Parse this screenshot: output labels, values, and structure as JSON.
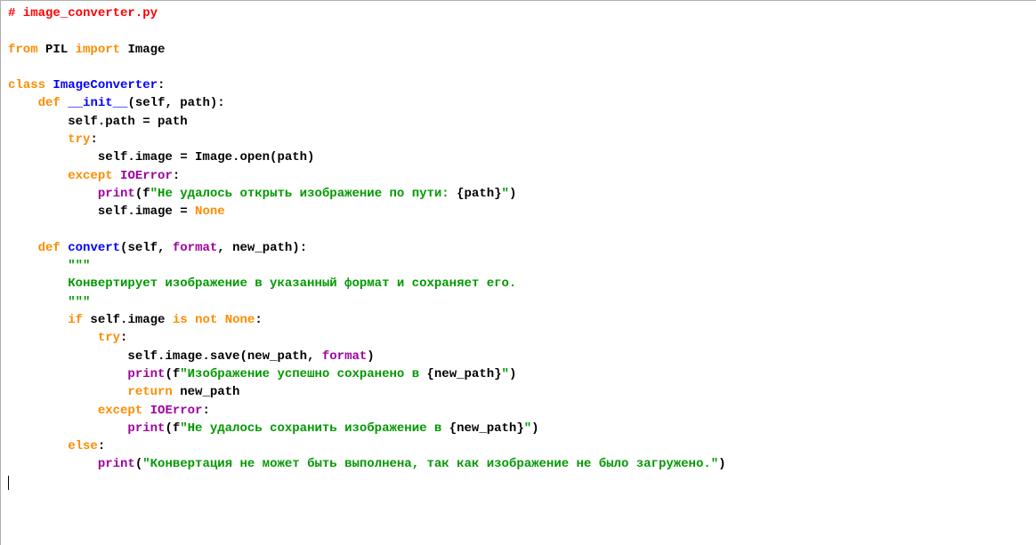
{
  "code": {
    "lines": [
      [
        {
          "cls": "c-comment",
          "text": "# image_converter.py"
        }
      ],
      [],
      [
        {
          "cls": "c-keyword",
          "text": "from"
        },
        {
          "cls": "c-text",
          "text": " PIL "
        },
        {
          "cls": "c-keyword",
          "text": "import"
        },
        {
          "cls": "c-text",
          "text": " Image"
        }
      ],
      [],
      [
        {
          "cls": "c-keyword",
          "text": "class"
        },
        {
          "cls": "c-text",
          "text": " "
        },
        {
          "cls": "c-name",
          "text": "ImageConverter"
        },
        {
          "cls": "c-punct",
          "text": ":"
        }
      ],
      [
        {
          "cls": "c-text",
          "text": "    "
        },
        {
          "cls": "c-keyword",
          "text": "def"
        },
        {
          "cls": "c-text",
          "text": " "
        },
        {
          "cls": "c-name",
          "text": "__init__"
        },
        {
          "cls": "c-punct",
          "text": "(self, path):"
        }
      ],
      [
        {
          "cls": "c-text",
          "text": "        self.path = path"
        }
      ],
      [
        {
          "cls": "c-text",
          "text": "        "
        },
        {
          "cls": "c-keyword",
          "text": "try"
        },
        {
          "cls": "c-punct",
          "text": ":"
        }
      ],
      [
        {
          "cls": "c-text",
          "text": "            self.image = Image.open(path)"
        }
      ],
      [
        {
          "cls": "c-text",
          "text": "        "
        },
        {
          "cls": "c-keyword",
          "text": "except"
        },
        {
          "cls": "c-text",
          "text": " "
        },
        {
          "cls": "c-builtin",
          "text": "IOError"
        },
        {
          "cls": "c-punct",
          "text": ":"
        }
      ],
      [
        {
          "cls": "c-text",
          "text": "            "
        },
        {
          "cls": "c-builtin",
          "text": "print"
        },
        {
          "cls": "c-punct",
          "text": "(f"
        },
        {
          "cls": "c-string",
          "text": "\"Не удалось открыть изображение по пути: "
        },
        {
          "cls": "c-punct",
          "text": "{"
        },
        {
          "cls": "c-text",
          "text": "path"
        },
        {
          "cls": "c-punct",
          "text": "}"
        },
        {
          "cls": "c-string",
          "text": "\""
        },
        {
          "cls": "c-punct",
          "text": ")"
        }
      ],
      [
        {
          "cls": "c-text",
          "text": "            self.image = "
        },
        {
          "cls": "c-keyword",
          "text": "None"
        }
      ],
      [],
      [
        {
          "cls": "c-text",
          "text": "    "
        },
        {
          "cls": "c-keyword",
          "text": "def"
        },
        {
          "cls": "c-text",
          "text": " "
        },
        {
          "cls": "c-name",
          "text": "convert"
        },
        {
          "cls": "c-punct",
          "text": "(self, "
        },
        {
          "cls": "c-builtin",
          "text": "format"
        },
        {
          "cls": "c-punct",
          "text": ", new_path):"
        }
      ],
      [
        {
          "cls": "c-text",
          "text": "        "
        },
        {
          "cls": "c-string",
          "text": "\"\"\""
        }
      ],
      [
        {
          "cls": "c-string",
          "text": "        Конвертирует изображение в указанный формат и сохраняет его."
        }
      ],
      [
        {
          "cls": "c-string",
          "text": "        \"\"\""
        }
      ],
      [
        {
          "cls": "c-text",
          "text": "        "
        },
        {
          "cls": "c-keyword",
          "text": "if"
        },
        {
          "cls": "c-text",
          "text": " self.image "
        },
        {
          "cls": "c-keyword",
          "text": "is"
        },
        {
          "cls": "c-text",
          "text": " "
        },
        {
          "cls": "c-keyword",
          "text": "not"
        },
        {
          "cls": "c-text",
          "text": " "
        },
        {
          "cls": "c-keyword",
          "text": "None"
        },
        {
          "cls": "c-punct",
          "text": ":"
        }
      ],
      [
        {
          "cls": "c-text",
          "text": "            "
        },
        {
          "cls": "c-keyword",
          "text": "try"
        },
        {
          "cls": "c-punct",
          "text": ":"
        }
      ],
      [
        {
          "cls": "c-text",
          "text": "                self.image.save(new_path, "
        },
        {
          "cls": "c-builtin",
          "text": "format"
        },
        {
          "cls": "c-punct",
          "text": ")"
        }
      ],
      [
        {
          "cls": "c-text",
          "text": "                "
        },
        {
          "cls": "c-builtin",
          "text": "print"
        },
        {
          "cls": "c-punct",
          "text": "(f"
        },
        {
          "cls": "c-string",
          "text": "\"Изображение успешно сохранено в "
        },
        {
          "cls": "c-punct",
          "text": "{"
        },
        {
          "cls": "c-text",
          "text": "new_path"
        },
        {
          "cls": "c-punct",
          "text": "}"
        },
        {
          "cls": "c-string",
          "text": "\""
        },
        {
          "cls": "c-punct",
          "text": ")"
        }
      ],
      [
        {
          "cls": "c-text",
          "text": "                "
        },
        {
          "cls": "c-keyword",
          "text": "return"
        },
        {
          "cls": "c-text",
          "text": " new_path"
        }
      ],
      [
        {
          "cls": "c-text",
          "text": "            "
        },
        {
          "cls": "c-keyword",
          "text": "except"
        },
        {
          "cls": "c-text",
          "text": " "
        },
        {
          "cls": "c-builtin",
          "text": "IOError"
        },
        {
          "cls": "c-punct",
          "text": ":"
        }
      ],
      [
        {
          "cls": "c-text",
          "text": "                "
        },
        {
          "cls": "c-builtin",
          "text": "print"
        },
        {
          "cls": "c-punct",
          "text": "(f"
        },
        {
          "cls": "c-string",
          "text": "\"Не удалось сохранить изображение в "
        },
        {
          "cls": "c-punct",
          "text": "{"
        },
        {
          "cls": "c-text",
          "text": "new_path"
        },
        {
          "cls": "c-punct",
          "text": "}"
        },
        {
          "cls": "c-string",
          "text": "\""
        },
        {
          "cls": "c-punct",
          "text": ")"
        }
      ],
      [
        {
          "cls": "c-text",
          "text": "        "
        },
        {
          "cls": "c-keyword",
          "text": "else"
        },
        {
          "cls": "c-punct",
          "text": ":"
        }
      ],
      [
        {
          "cls": "c-text",
          "text": "            "
        },
        {
          "cls": "c-builtin",
          "text": "print"
        },
        {
          "cls": "c-punct",
          "text": "("
        },
        {
          "cls": "c-string",
          "text": "\"Конвертация не может быть выполнена, так как изображение не было загружено.\""
        },
        {
          "cls": "c-punct",
          "text": ")"
        }
      ]
    ]
  }
}
